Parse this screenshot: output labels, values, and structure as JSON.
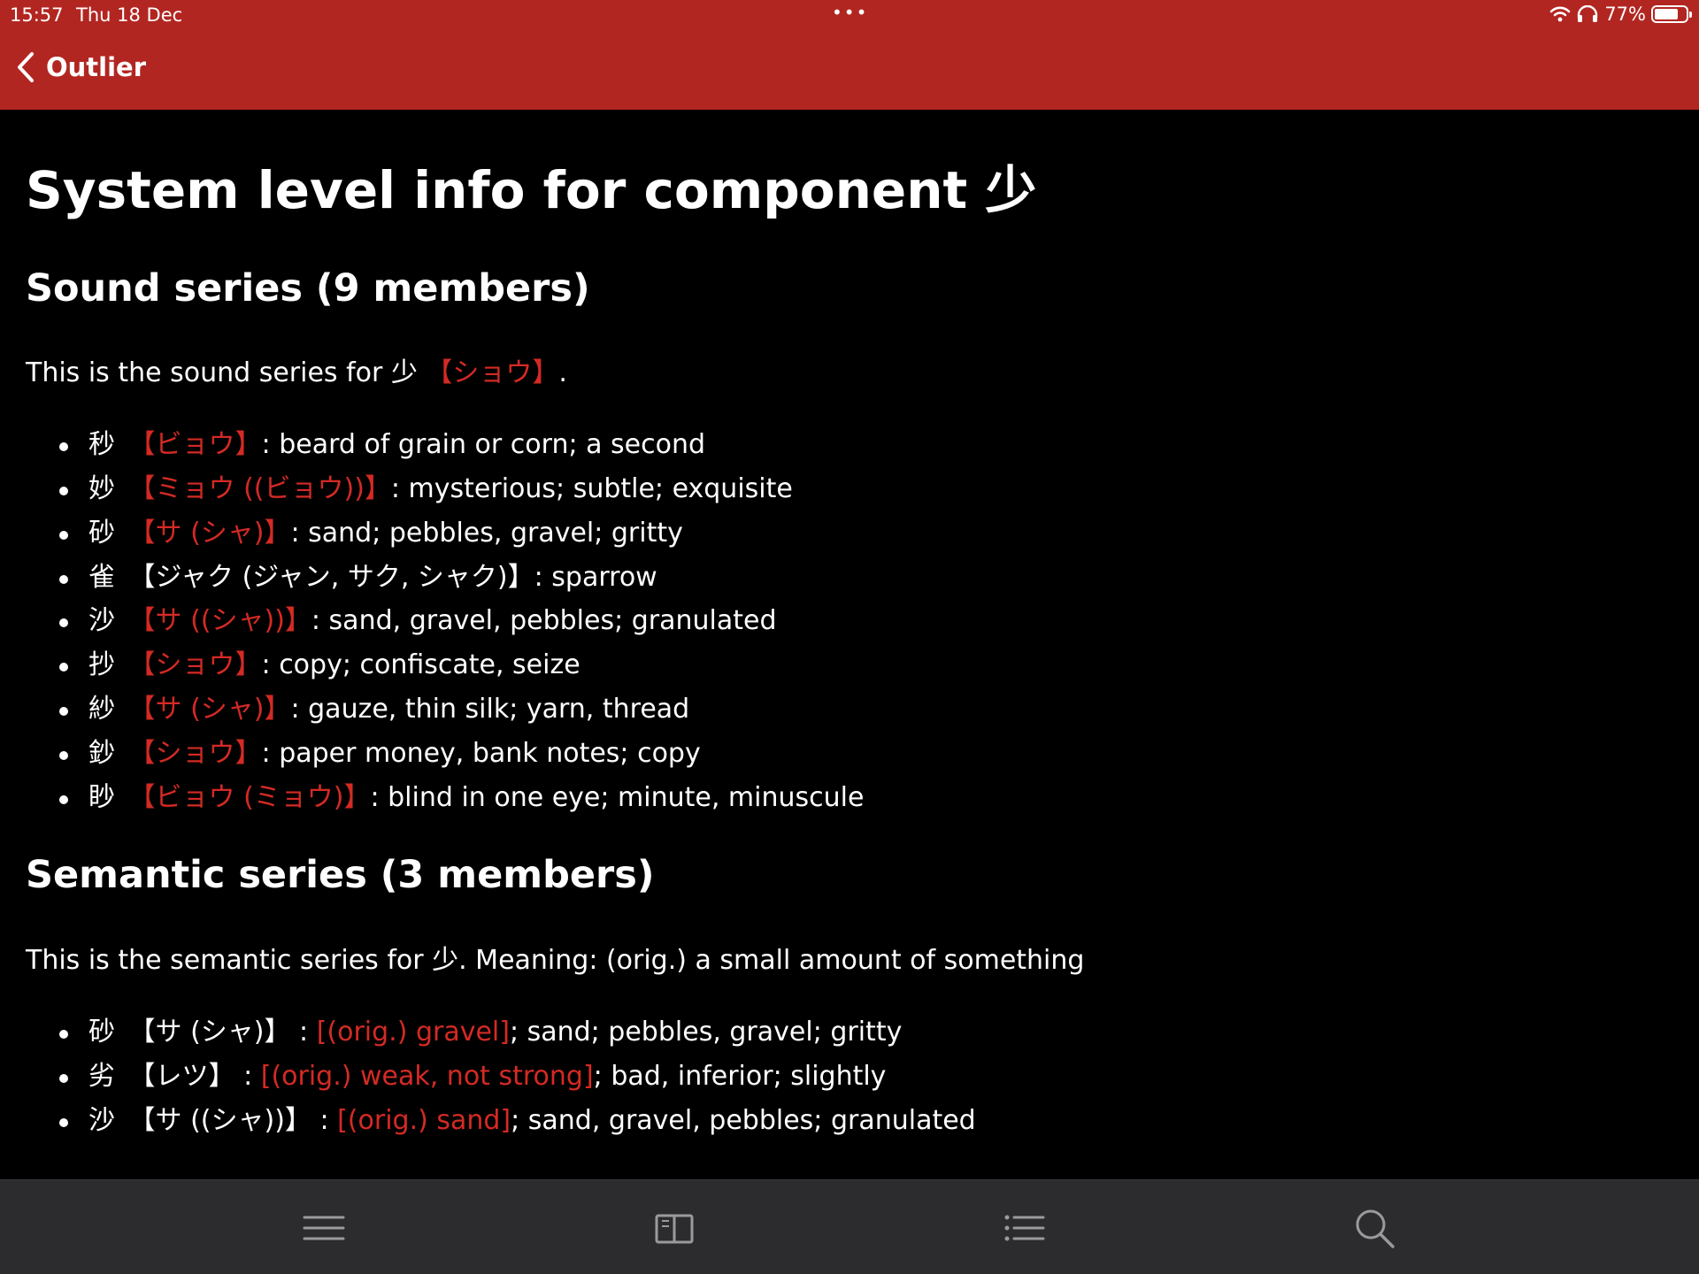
{
  "status": {
    "time": "15:57",
    "date": "Thu 18 Dec",
    "dots": "•••",
    "battery_percent": "77%",
    "battery_level": 0.77
  },
  "nav": {
    "back_label": "Outlier"
  },
  "page": {
    "title": "System level info for component 少"
  },
  "sound": {
    "heading": "Sound series (9 members)",
    "intro_prefix": "This is the sound series for 少 ",
    "intro_reading": "【ショウ】",
    "intro_suffix": ".",
    "items": [
      {
        "kanji": "秒",
        "reading": "【ビョウ】",
        "meaning": ": beard of grain or corn; a second",
        "red": true
      },
      {
        "kanji": "妙",
        "reading": "【ミョウ ((ビョウ))】",
        "meaning": ": mysterious; subtle; exquisite",
        "red": true
      },
      {
        "kanji": "砂",
        "reading": "【サ (シャ)】",
        "meaning": ": sand; pebbles, gravel; gritty",
        "red": true
      },
      {
        "kanji": "雀",
        "reading": "【ジャク (ジャン, サク, シャク)】",
        "meaning": ": sparrow",
        "red": false
      },
      {
        "kanji": "沙",
        "reading": "【サ ((シャ))】",
        "meaning": ": sand, gravel, pebbles; granulated",
        "red": true
      },
      {
        "kanji": "抄",
        "reading": "【ショウ】",
        "meaning": ": copy; confiscate, seize",
        "red": true
      },
      {
        "kanji": "紗",
        "reading": "【サ (シャ)】",
        "meaning": ": gauze, thin silk; yarn, thread",
        "red": true
      },
      {
        "kanji": "鈔",
        "reading": "【ショウ】",
        "meaning": ": paper money, bank notes; copy",
        "red": true
      },
      {
        "kanji": "眇",
        "reading": "【ビョウ (ミョウ)】",
        "meaning": ": blind in one eye; minute, minuscule",
        "red": true
      }
    ]
  },
  "semantic": {
    "heading": "Semantic series (3 members)",
    "intro": "This is the semantic series for 少. Meaning: (orig.) a small amount of something",
    "items": [
      {
        "kanji": "砂",
        "reading": "【サ (シャ)】",
        "sep": " : ",
        "orig": "[(orig.) gravel]",
        "meaning": "; sand; pebbles, gravel; gritty"
      },
      {
        "kanji": "劣",
        "reading": "【レツ】",
        "sep": " : ",
        "orig": "[(orig.) weak, not strong]",
        "meaning": "; bad, inferior; slightly"
      },
      {
        "kanji": "沙",
        "reading": "【サ ((シャ))】",
        "sep": " : ",
        "orig": "[(orig.) sand]",
        "meaning": "; sand, gravel, pebbles; granulated"
      }
    ]
  },
  "colors": {
    "bar": "#b22621",
    "accent": "#d42a24",
    "background": "#000000",
    "tabbar": "#2c2c2e"
  },
  "tabs": [
    {
      "name": "menu-icon"
    },
    {
      "name": "book-icon"
    },
    {
      "name": "list-icon"
    },
    {
      "name": "search-icon"
    }
  ]
}
